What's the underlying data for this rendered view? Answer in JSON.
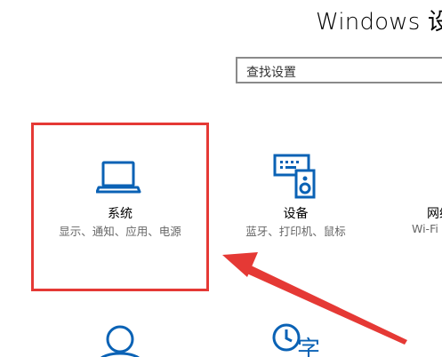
{
  "window": {
    "title": "Windows 设置"
  },
  "search": {
    "placeholder": "查找设置"
  },
  "tiles": [
    {
      "name": "系统",
      "desc": "显示、通知、应用、电源",
      "icon": "laptop-icon"
    },
    {
      "name": "设备",
      "desc": "蓝牙、打印机、鼠标",
      "icon": "devices-icon"
    },
    {
      "name": "网络",
      "desc": "Wi-Fi",
      "icon": "network-icon"
    },
    {
      "name": "",
      "desc": "",
      "icon": "account-icon"
    },
    {
      "name": "",
      "desc": "",
      "icon": "time-language-icon"
    }
  ],
  "annotation": {
    "highlight_color": "#e53935",
    "arrow_color": "#e53935"
  },
  "colors": {
    "accent": "#0a62b5"
  }
}
